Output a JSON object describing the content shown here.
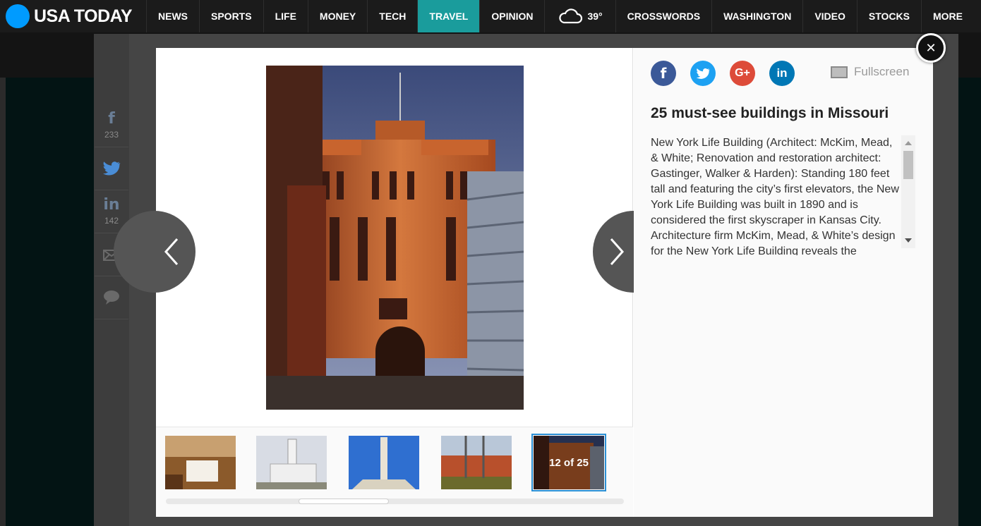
{
  "header": {
    "logo_text": "USA TODAY",
    "nav": [
      "NEWS",
      "SPORTS",
      "LIFE",
      "MONEY",
      "TECH",
      "TRAVEL",
      "OPINION"
    ],
    "active_nav": "TRAVEL",
    "weather": {
      "icon": "cloud-icon",
      "temperature": "39°"
    },
    "nav_right": [
      "CROSSWORDS",
      "WASHINGTON",
      "VIDEO",
      "STOCKS",
      "MORE"
    ]
  },
  "share_rail": {
    "facebook": {
      "icon": "facebook-icon",
      "count": "233"
    },
    "twitter": {
      "icon": "twitter-icon"
    },
    "linkedin": {
      "icon": "linkedin-icon",
      "count": "142"
    },
    "email": {
      "icon": "email-icon"
    },
    "comment": {
      "icon": "comment-icon"
    }
  },
  "gallery": {
    "title": "25 must-see buildings in Missouri",
    "caption": "New York Life Building (Architect: McKim, Mead, & White; Renovation and restoration architect: Gastinger, Walker & Harden): Standing 180 feet tall and featuring the city’s first elevators, the New York Life Building was built in 1890 and is considered the first skyscraper in Kansas City. Architecture firm McKim, Mead, & White’s design for the New York Life Building reveals the",
    "fullscreen_label": "Fullscreen",
    "current_label": "12 of 25",
    "thumbnail_scroll_fraction": 0.29
  },
  "social_buttons": [
    {
      "name": "facebook",
      "glyph": "f",
      "color": "#3b5998"
    },
    {
      "name": "twitter",
      "glyph": "t",
      "color": "#1da1f2"
    },
    {
      "name": "google-plus",
      "glyph": "G+",
      "color": "#dd4b39"
    },
    {
      "name": "linkedin",
      "glyph": "in",
      "color": "#0077b5"
    }
  ],
  "colors": {
    "nav_bg": "#1b1b1b",
    "nav_active": "#1a9c9c",
    "logo_dot": "#009bff",
    "thumb_selected": "#2a8fd4"
  }
}
